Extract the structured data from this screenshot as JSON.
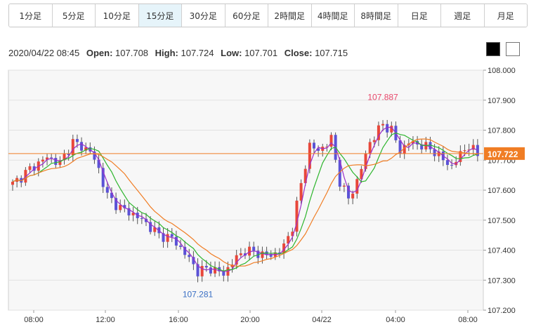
{
  "timeframes": [
    {
      "label": "1分足",
      "active": false
    },
    {
      "label": "5分足",
      "active": false
    },
    {
      "label": "10分足",
      "active": false
    },
    {
      "label": "15分足",
      "active": true
    },
    {
      "label": "30分足",
      "active": false
    },
    {
      "label": "60分足",
      "active": false
    },
    {
      "label": "2時間足",
      "active": false
    },
    {
      "label": "4時間足",
      "active": false
    },
    {
      "label": "8時間足",
      "active": false
    },
    {
      "label": "日足",
      "active": false
    },
    {
      "label": "週足",
      "active": false
    },
    {
      "label": "月足",
      "active": false
    }
  ],
  "ohlc": {
    "datetime": "2020/04/22 08:45",
    "open_label": "Open:",
    "open": "107.708",
    "high_label": "High:",
    "high": "107.724",
    "low_label": "Low:",
    "low": "107.701",
    "close_label": "Close:",
    "close": "107.715"
  },
  "colors": {
    "up": "#e8473a",
    "down": "#5b52d6",
    "ma_short": "#9b2fc9",
    "ma_mid": "#2db52d",
    "ma_long": "#f07d24",
    "price_line": "#f07d24",
    "high_label": "#e8476a",
    "low_label": "#3a6fc4"
  },
  "chart_data": {
    "type": "candlestick",
    "y_ticks": [
      "108.000",
      "107.900",
      "107.800",
      "107.700",
      "107.600",
      "107.500",
      "107.400",
      "107.300",
      "107.200"
    ],
    "ylim": [
      107.2,
      108.0
    ],
    "x_ticks": [
      "08:00",
      "12:00",
      "16:00",
      "20:00",
      "04/22",
      "04:00",
      "08:00"
    ],
    "current_price": "107.722",
    "high_annotation": "107.887",
    "low_annotation": "107.281",
    "anchors": [
      [
        0,
        107.62
      ],
      [
        4,
        107.67
      ],
      [
        8,
        107.71
      ],
      [
        11,
        107.69
      ],
      [
        14,
        107.76
      ],
      [
        18,
        107.73
      ],
      [
        20,
        107.67
      ],
      [
        22,
        107.58
      ],
      [
        25,
        107.54
      ],
      [
        28,
        107.52
      ],
      [
        31,
        107.49
      ],
      [
        34,
        107.45
      ],
      [
        37,
        107.44
      ],
      [
        40,
        107.39
      ],
      [
        43,
        107.33
      ],
      [
        46,
        107.34
      ],
      [
        49,
        107.32
      ],
      [
        51,
        107.36
      ],
      [
        54,
        107.4
      ],
      [
        57,
        107.39
      ],
      [
        60,
        107.38
      ],
      [
        63,
        107.41
      ],
      [
        65,
        107.48
      ],
      [
        67,
        107.62
      ],
      [
        69,
        107.75
      ],
      [
        71,
        107.73
      ],
      [
        74,
        107.77
      ],
      [
        76,
        107.63
      ],
      [
        78,
        107.57
      ],
      [
        80,
        107.63
      ],
      [
        83,
        107.76
      ],
      [
        86,
        107.82
      ],
      [
        88,
        107.8
      ],
      [
        90,
        107.73
      ],
      [
        92,
        107.76
      ],
      [
        95,
        107.75
      ],
      [
        98,
        107.73
      ],
      [
        100,
        107.7
      ],
      [
        102,
        107.68
      ],
      [
        104,
        107.72
      ],
      [
        106,
        107.75
      ],
      [
        108,
        107.715
      ]
    ],
    "gap_after_index": [
      95
    ]
  }
}
